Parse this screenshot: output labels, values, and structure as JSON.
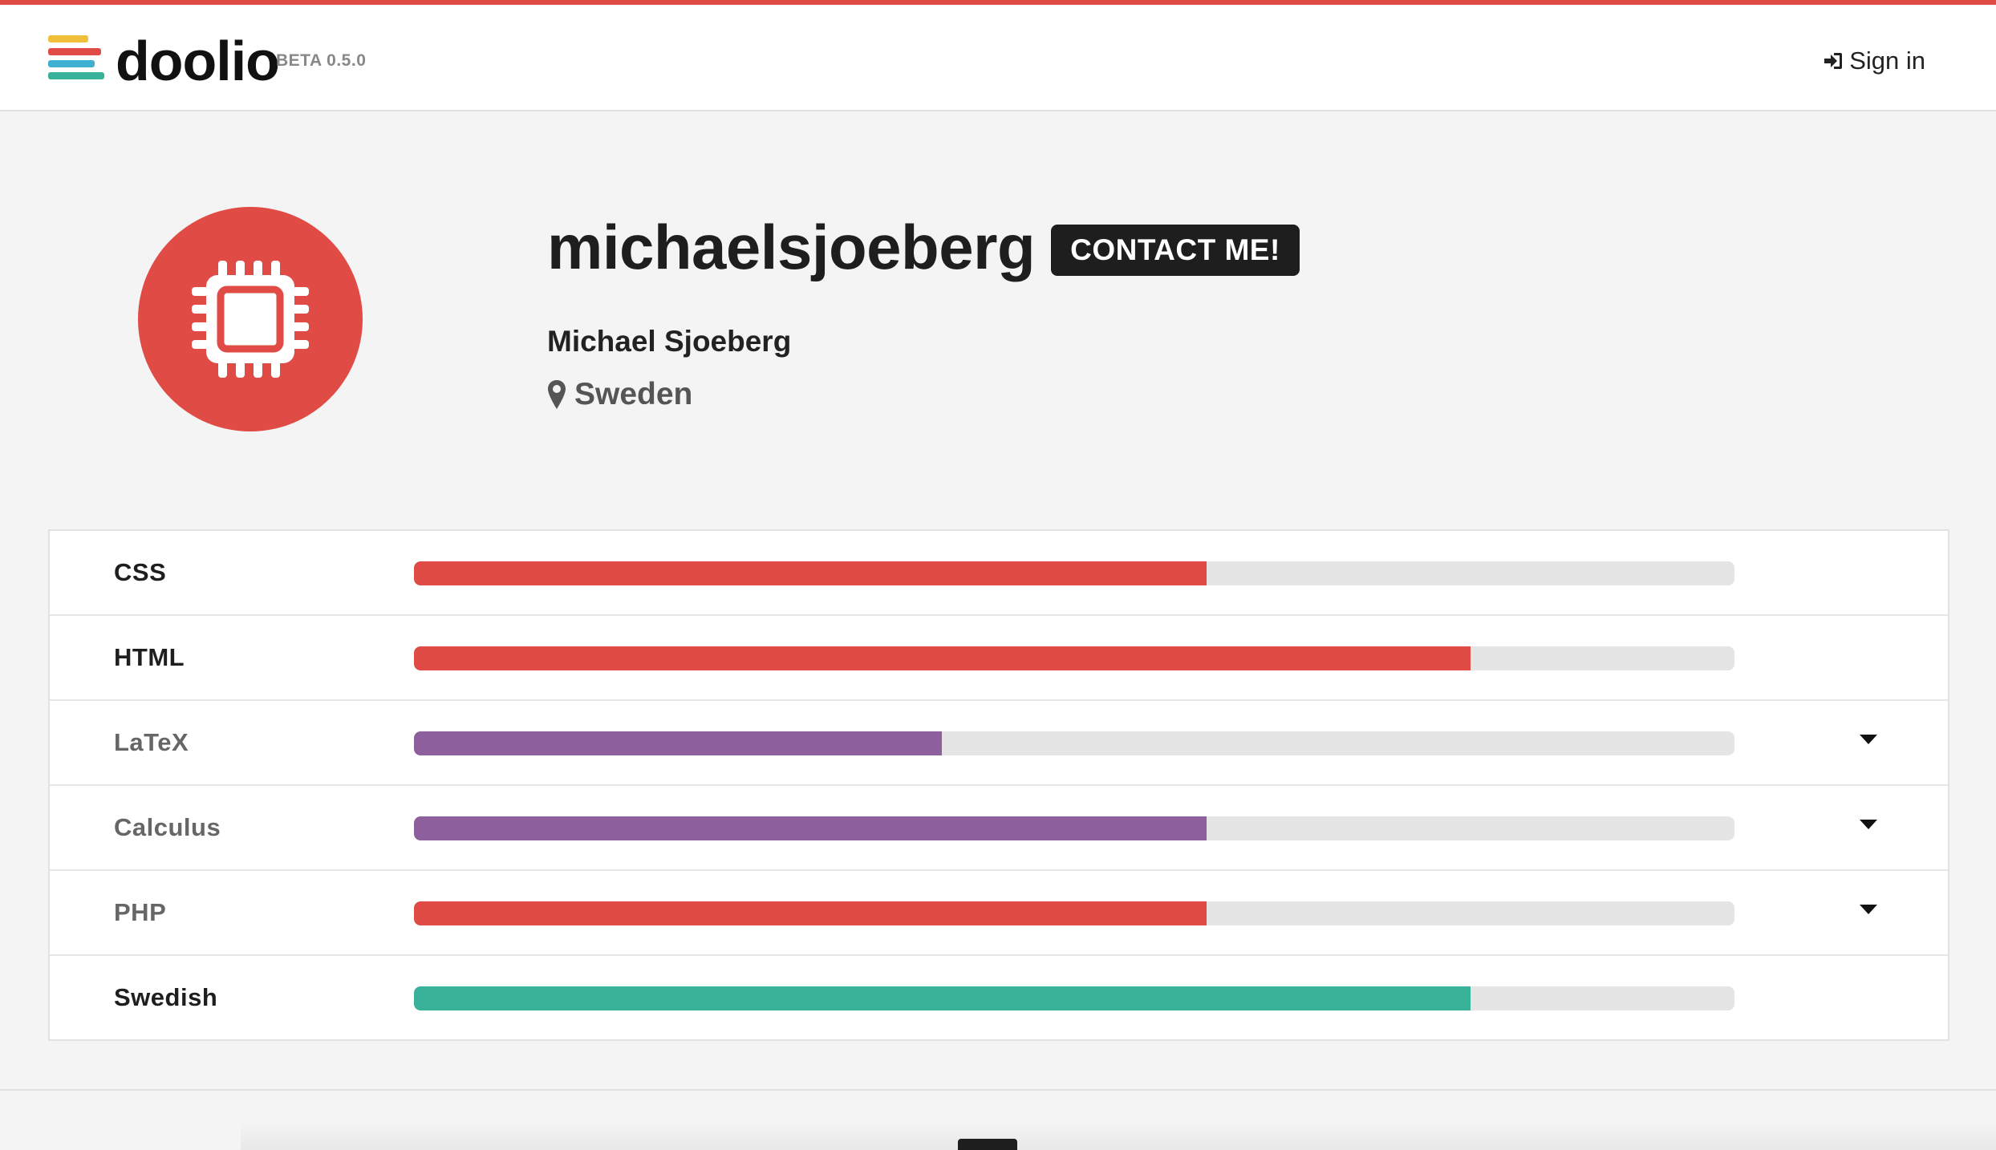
{
  "header": {
    "logo_text": "doolio",
    "version": "BETA 0.5.0",
    "signin_label": "Sign in",
    "logo_colors": [
      "#f0c03a",
      "#e14b45",
      "#3fb0d0",
      "#38b39a"
    ],
    "accent": "#e14b45"
  },
  "profile": {
    "username": "michaelsjoeberg",
    "contact_label": "CONTACT ME!",
    "full_name": "Michael Sjoeberg",
    "location": "Sweden",
    "avatar_icon": "cpu-chip-icon"
  },
  "skills": [
    {
      "name": "CSS",
      "level": 0.6,
      "color": "#e14b45",
      "bold": true,
      "expandable": false
    },
    {
      "name": "HTML",
      "level": 0.8,
      "color": "#e14b45",
      "bold": true,
      "expandable": false
    },
    {
      "name": "LaTeX",
      "level": 0.4,
      "color": "#8e5f9d",
      "bold": false,
      "expandable": true
    },
    {
      "name": "Calculus",
      "level": 0.6,
      "color": "#8e5f9d",
      "bold": false,
      "expandable": true
    },
    {
      "name": "PHP",
      "level": 0.6,
      "color": "#e14b45",
      "bold": false,
      "expandable": true
    },
    {
      "name": "Swedish",
      "level": 0.8,
      "color": "#38b39a",
      "bold": true,
      "expandable": false
    }
  ]
}
